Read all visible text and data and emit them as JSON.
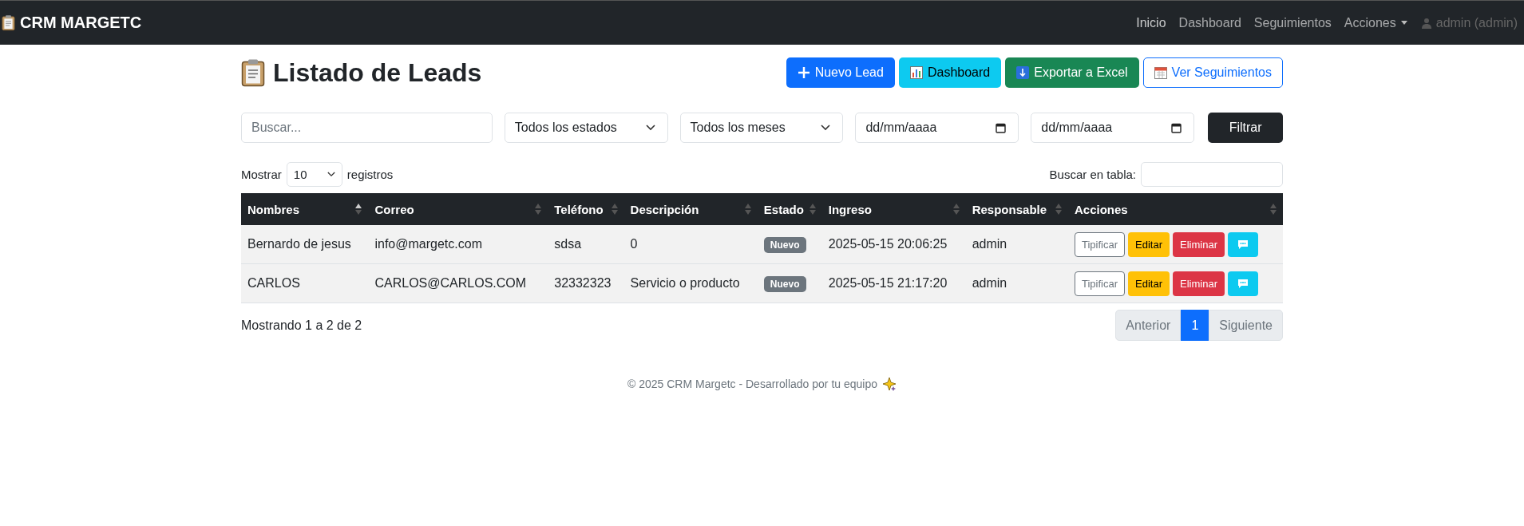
{
  "navbar": {
    "brand": "CRM MARGETC",
    "links": [
      {
        "label": "Inicio",
        "kind": "link"
      },
      {
        "label": "Dashboard",
        "kind": "link"
      },
      {
        "label": "Seguimientos",
        "kind": "link"
      },
      {
        "label": "Acciones",
        "kind": "dropdown"
      },
      {
        "label": "admin (admin)",
        "kind": "user"
      }
    ]
  },
  "title": "Listado de Leads",
  "actions": [
    {
      "label": "Nuevo Lead",
      "kind": "new"
    },
    {
      "label": "Dashboard",
      "kind": "dashboard"
    },
    {
      "label": "Exportar a Excel",
      "kind": "export"
    },
    {
      "label": "Ver Seguimientos",
      "kind": "followup"
    }
  ],
  "filters": {
    "search": {
      "placeholder": "Buscar..."
    },
    "status": "Todos los estados",
    "month": "Todos los meses",
    "date_from": "dd/mm/aaaa",
    "date_to": "dd/mm/aaaa",
    "button": "Filtrar"
  },
  "length": {
    "label_before": "Mostrar",
    "value": "10",
    "label_after": "registros"
  },
  "table_search": {
    "label": "Buscar en tabla:"
  },
  "table": {
    "columns": [
      {
        "label": "Nombres",
        "sorted": true
      },
      {
        "label": "Correo",
        "sorted": false
      },
      {
        "label": "Teléfono",
        "sorted": false
      },
      {
        "label": "Descripción",
        "sorted": false
      },
      {
        "label": "Estado",
        "sorted": false
      },
      {
        "label": "Ingreso",
        "sorted": false
      },
      {
        "label": "Responsable",
        "sorted": false
      },
      {
        "label": "Acciones",
        "sorted": false
      }
    ],
    "rows": [
      {
        "cells": [
          "Bernardo de jesus",
          "info@margetc.com",
          "sdsa",
          "0"
        ],
        "status": "Nuevo",
        "date": "2025-05-15 20:06:25",
        "owner": "admin",
        "buttons": [
          "Tipificar",
          "Editar",
          "Eliminar"
        ]
      },
      {
        "cells": [
          "CARLOS",
          "CARLOS@CARLOS.COM",
          "32332323",
          "Servicio o producto"
        ],
        "status": "Nuevo",
        "date": "2025-05-15 21:17:20",
        "owner": "admin",
        "buttons": [
          "Tipificar",
          "Editar",
          "Eliminar"
        ]
      }
    ]
  },
  "info": "Mostrando 1 a 2 de 2",
  "pagination": {
    "previous": "Anterior",
    "pages": [
      {
        "label": "1",
        "selected": true
      }
    ],
    "next": "Siguiente"
  },
  "footer": "© 2025 CRM Margetc - Desarrollado por tu equipo"
}
